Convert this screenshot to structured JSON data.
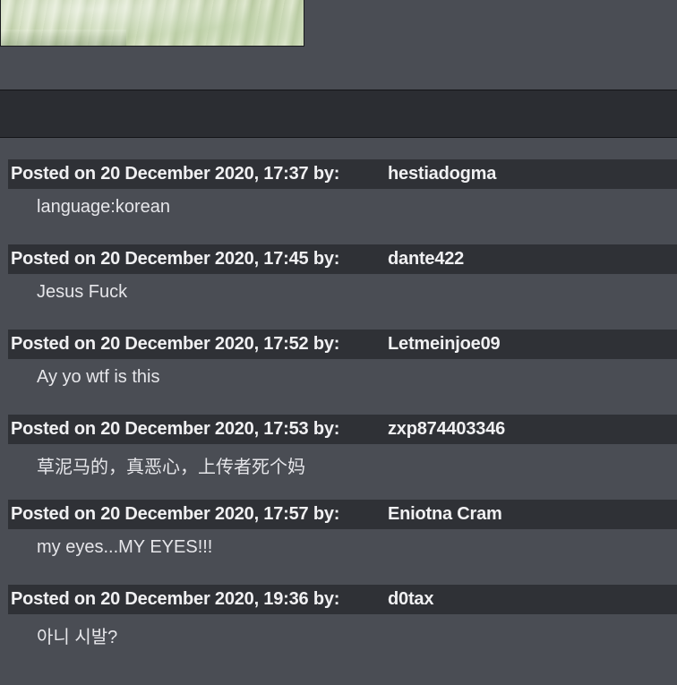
{
  "comments": [
    {
      "posted": "Posted on 20 December 2020, 17:37 by:",
      "user": "hestiadogma",
      "text": "language:korean"
    },
    {
      "posted": "Posted on 20 December 2020, 17:45 by:",
      "user": "dante422",
      "text": "Jesus Fuck"
    },
    {
      "posted": "Posted on 20 December 2020, 17:52 by:",
      "user": "Letmeinjoe09",
      "text": "Ay yo wtf is this"
    },
    {
      "posted": "Posted on 20 December 2020, 17:53 by:",
      "user": "zxp874403346",
      "text": "草泥马的，真恶心，上传者死个妈"
    },
    {
      "posted": "Posted on 20 December 2020, 17:57 by:",
      "user": "Eniotna Cram",
      "text": "my eyes...MY EYES!!!"
    },
    {
      "posted": "Posted on 20 December 2020, 19:36 by:",
      "user": "d0tax",
      "text": "아니 시발?"
    }
  ]
}
